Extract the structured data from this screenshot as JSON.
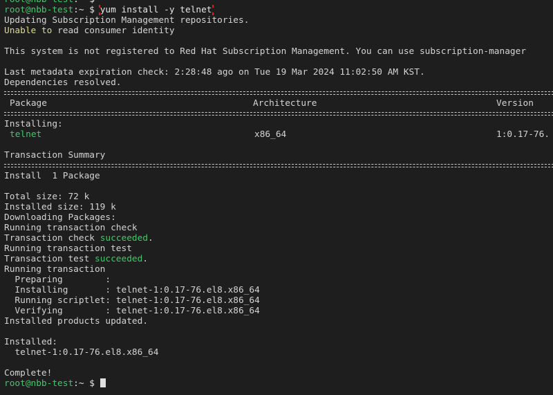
{
  "prompt": {
    "user_host": "root@nbb-test",
    "path": ":~ ",
    "symbol": "$ "
  },
  "command": "yum install -y telnet",
  "lines": {
    "updating": "Updating Subscription Management repositories.",
    "unable_word1": "Unable",
    "unable_word2": " to",
    "unable_rest": " read consumer identity",
    "not_registered": "This system is not registered to Red Hat Subscription Management. You can use subscription-manager",
    "metadata": "Last metadata expiration check: 2:28:48 ago on Tue 19 Mar 2024 11:02:50 AM KST.",
    "deps": "Dependencies resolved.",
    "installing_header": "Installing:",
    "transaction_summary": "Transaction Summary",
    "install_count": "Install  1 Package",
    "total_size": "Total size: 72 k",
    "installed_size": "Installed size: 119 k",
    "downloading": "Downloading Packages:",
    "running_check": "Running transaction check",
    "check_prefix": "Transaction check ",
    "succeeded": "succeeded",
    "period": ".",
    "running_test": "Running transaction test",
    "test_prefix": "Transaction test ",
    "running_transaction": "Running transaction",
    "preparing": "  Preparing        :",
    "installing_step": "  Installing       : telnet-1:0.17-76.el8.x86_64",
    "scriptlet_step": "  Running scriptlet: telnet-1:0.17-76.el8.x86_64",
    "verifying_step": "  Verifying        : telnet-1:0.17-76.el8.x86_64",
    "products_updated": "Installed products updated.",
    "installed_header": "Installed:",
    "installed_pkg": "  telnet-1:0.17-76.el8.x86_64",
    "complete": "Complete!"
  },
  "table": {
    "headers": {
      "package": "Package",
      "architecture": "Architecture",
      "version": "Version"
    },
    "row": {
      "package": "telnet",
      "architecture": "x86_64",
      "version": "1:0.17-76."
    }
  },
  "colors": {
    "background": "#1e1e1e",
    "prompt_green": "#3fc96b",
    "path_blue": "#5aa9f0",
    "warning_yellow": "#dcdc8a",
    "highlight_red": "#e02020"
  }
}
